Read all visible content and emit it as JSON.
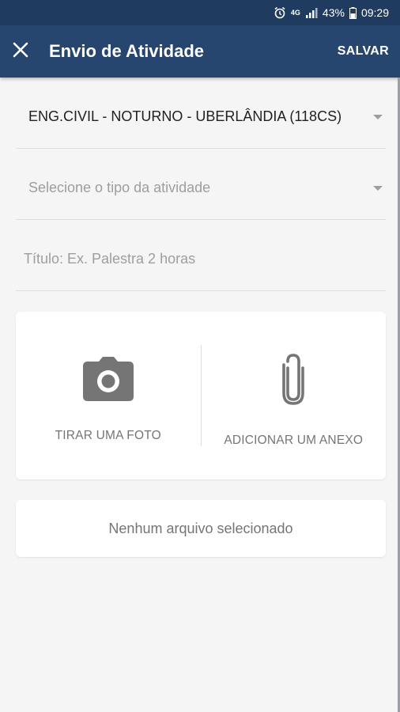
{
  "status_bar": {
    "network": "4G",
    "battery": "43%",
    "time": "09:29"
  },
  "app_bar": {
    "title": "Envio de Atividade",
    "save_label": "SALVAR"
  },
  "form": {
    "course_value": "ENG.CIVIL - NOTURNO - UBERLÂNDIA (118CS)",
    "type_placeholder": "Selecione o tipo da atividade",
    "title_placeholder": "Título: Ex. Palestra 2 horas"
  },
  "attachments": {
    "photo_label": "TIRAR UMA FOTO",
    "file_label": "ADICIONAR UM ANEXO"
  },
  "selection_status": "Nenhum arquivo selecionado",
  "colors": {
    "status_bar": "#1f3c60",
    "app_bar": "#27466f",
    "icon_gray": "#757575",
    "background": "#f5f5f5"
  }
}
